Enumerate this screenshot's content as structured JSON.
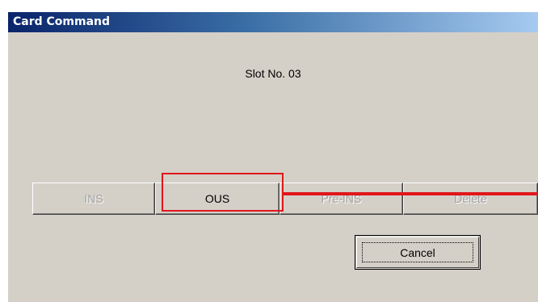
{
  "window": {
    "title": "Card Command"
  },
  "slot_text": "Slot No.  03",
  "buttons": {
    "ins": "INS",
    "ous": "OUS",
    "pre_ins": "Pre-INS",
    "delete": "Delete",
    "cancel": "Cancel"
  },
  "colors": {
    "dialog_bg": "#d4d0c8",
    "title_gradient_start": "#0a246a",
    "title_gradient_end": "#a6caf0",
    "annotation_red": "#e0161b"
  }
}
